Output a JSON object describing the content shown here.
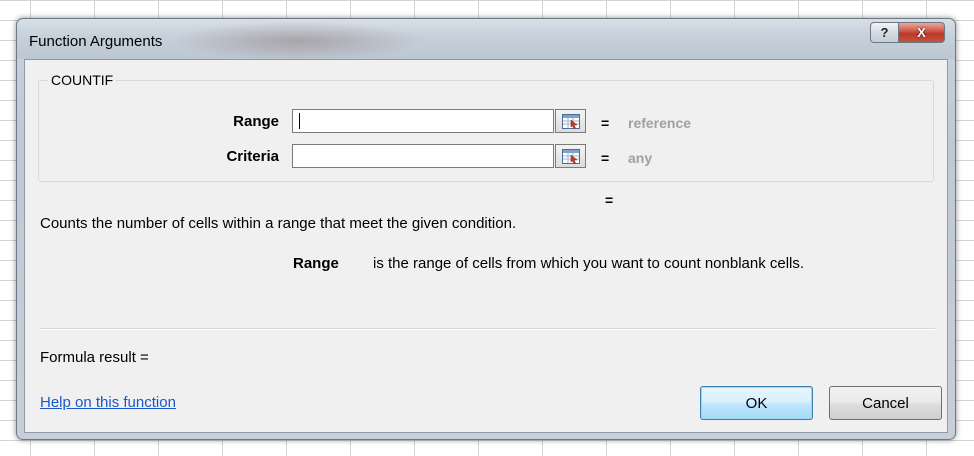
{
  "window": {
    "title": "Function Arguments",
    "help_glyph": "?",
    "close_glyph": "X"
  },
  "function": {
    "name": "COUNTIF",
    "arguments": [
      {
        "label": "Range",
        "value": "",
        "result": "reference"
      },
      {
        "label": "Criteria",
        "value": "",
        "result": "any"
      }
    ],
    "equals_sign": "=",
    "overall_result_sign": "=",
    "description": "Counts the number of cells within a range that meet the given condition.",
    "current_arg_name": "Range",
    "current_arg_description": "is the range of cells from which you want to count nonblank cells."
  },
  "footer": {
    "formula_result_label": "Formula result =",
    "help_link": "Help on this function",
    "ok_label": "OK",
    "cancel_label": "Cancel"
  },
  "icons": {
    "collapse": "collapse-dialog-icon",
    "help": "help-icon",
    "close": "close-icon"
  },
  "colors": {
    "link": "#1a58c8",
    "hint": "#a0a0a0",
    "close_button": "#c7523b"
  }
}
